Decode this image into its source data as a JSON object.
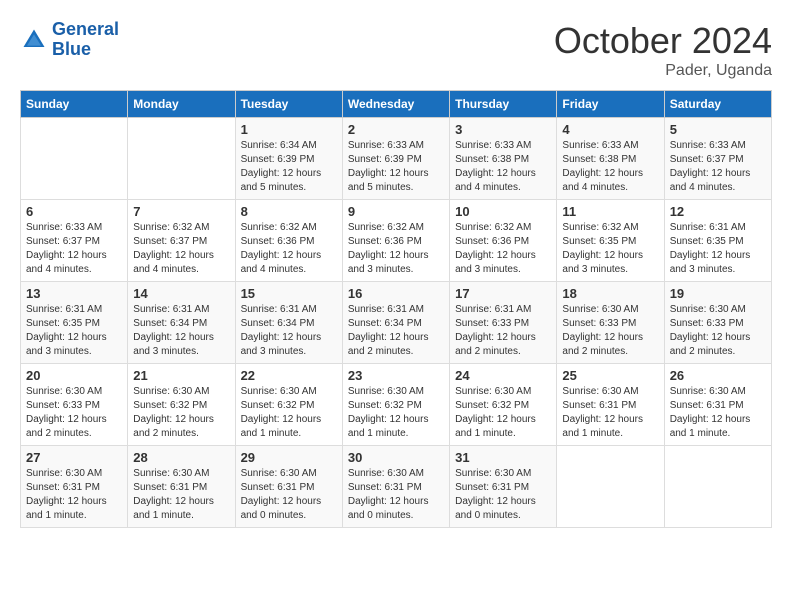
{
  "logo": {
    "line1": "General",
    "line2": "Blue"
  },
  "title": "October 2024",
  "subtitle": "Pader, Uganda",
  "days_header": [
    "Sunday",
    "Monday",
    "Tuesday",
    "Wednesday",
    "Thursday",
    "Friday",
    "Saturday"
  ],
  "weeks": [
    [
      {
        "num": "",
        "info": ""
      },
      {
        "num": "",
        "info": ""
      },
      {
        "num": "1",
        "info": "Sunrise: 6:34 AM\nSunset: 6:39 PM\nDaylight: 12 hours\nand 5 minutes."
      },
      {
        "num": "2",
        "info": "Sunrise: 6:33 AM\nSunset: 6:39 PM\nDaylight: 12 hours\nand 5 minutes."
      },
      {
        "num": "3",
        "info": "Sunrise: 6:33 AM\nSunset: 6:38 PM\nDaylight: 12 hours\nand 4 minutes."
      },
      {
        "num": "4",
        "info": "Sunrise: 6:33 AM\nSunset: 6:38 PM\nDaylight: 12 hours\nand 4 minutes."
      },
      {
        "num": "5",
        "info": "Sunrise: 6:33 AM\nSunset: 6:37 PM\nDaylight: 12 hours\nand 4 minutes."
      }
    ],
    [
      {
        "num": "6",
        "info": "Sunrise: 6:33 AM\nSunset: 6:37 PM\nDaylight: 12 hours\nand 4 minutes."
      },
      {
        "num": "7",
        "info": "Sunrise: 6:32 AM\nSunset: 6:37 PM\nDaylight: 12 hours\nand 4 minutes."
      },
      {
        "num": "8",
        "info": "Sunrise: 6:32 AM\nSunset: 6:36 PM\nDaylight: 12 hours\nand 4 minutes."
      },
      {
        "num": "9",
        "info": "Sunrise: 6:32 AM\nSunset: 6:36 PM\nDaylight: 12 hours\nand 3 minutes."
      },
      {
        "num": "10",
        "info": "Sunrise: 6:32 AM\nSunset: 6:36 PM\nDaylight: 12 hours\nand 3 minutes."
      },
      {
        "num": "11",
        "info": "Sunrise: 6:32 AM\nSunset: 6:35 PM\nDaylight: 12 hours\nand 3 minutes."
      },
      {
        "num": "12",
        "info": "Sunrise: 6:31 AM\nSunset: 6:35 PM\nDaylight: 12 hours\nand 3 minutes."
      }
    ],
    [
      {
        "num": "13",
        "info": "Sunrise: 6:31 AM\nSunset: 6:35 PM\nDaylight: 12 hours\nand 3 minutes."
      },
      {
        "num": "14",
        "info": "Sunrise: 6:31 AM\nSunset: 6:34 PM\nDaylight: 12 hours\nand 3 minutes."
      },
      {
        "num": "15",
        "info": "Sunrise: 6:31 AM\nSunset: 6:34 PM\nDaylight: 12 hours\nand 3 minutes."
      },
      {
        "num": "16",
        "info": "Sunrise: 6:31 AM\nSunset: 6:34 PM\nDaylight: 12 hours\nand 2 minutes."
      },
      {
        "num": "17",
        "info": "Sunrise: 6:31 AM\nSunset: 6:33 PM\nDaylight: 12 hours\nand 2 minutes."
      },
      {
        "num": "18",
        "info": "Sunrise: 6:30 AM\nSunset: 6:33 PM\nDaylight: 12 hours\nand 2 minutes."
      },
      {
        "num": "19",
        "info": "Sunrise: 6:30 AM\nSunset: 6:33 PM\nDaylight: 12 hours\nand 2 minutes."
      }
    ],
    [
      {
        "num": "20",
        "info": "Sunrise: 6:30 AM\nSunset: 6:33 PM\nDaylight: 12 hours\nand 2 minutes."
      },
      {
        "num": "21",
        "info": "Sunrise: 6:30 AM\nSunset: 6:32 PM\nDaylight: 12 hours\nand 2 minutes."
      },
      {
        "num": "22",
        "info": "Sunrise: 6:30 AM\nSunset: 6:32 PM\nDaylight: 12 hours\nand 1 minute."
      },
      {
        "num": "23",
        "info": "Sunrise: 6:30 AM\nSunset: 6:32 PM\nDaylight: 12 hours\nand 1 minute."
      },
      {
        "num": "24",
        "info": "Sunrise: 6:30 AM\nSunset: 6:32 PM\nDaylight: 12 hours\nand 1 minute."
      },
      {
        "num": "25",
        "info": "Sunrise: 6:30 AM\nSunset: 6:31 PM\nDaylight: 12 hours\nand 1 minute."
      },
      {
        "num": "26",
        "info": "Sunrise: 6:30 AM\nSunset: 6:31 PM\nDaylight: 12 hours\nand 1 minute."
      }
    ],
    [
      {
        "num": "27",
        "info": "Sunrise: 6:30 AM\nSunset: 6:31 PM\nDaylight: 12 hours\nand 1 minute."
      },
      {
        "num": "28",
        "info": "Sunrise: 6:30 AM\nSunset: 6:31 PM\nDaylight: 12 hours\nand 1 minute."
      },
      {
        "num": "29",
        "info": "Sunrise: 6:30 AM\nSunset: 6:31 PM\nDaylight: 12 hours\nand 0 minutes."
      },
      {
        "num": "30",
        "info": "Sunrise: 6:30 AM\nSunset: 6:31 PM\nDaylight: 12 hours\nand 0 minutes."
      },
      {
        "num": "31",
        "info": "Sunrise: 6:30 AM\nSunset: 6:31 PM\nDaylight: 12 hours\nand 0 minutes."
      },
      {
        "num": "",
        "info": ""
      },
      {
        "num": "",
        "info": ""
      }
    ]
  ]
}
